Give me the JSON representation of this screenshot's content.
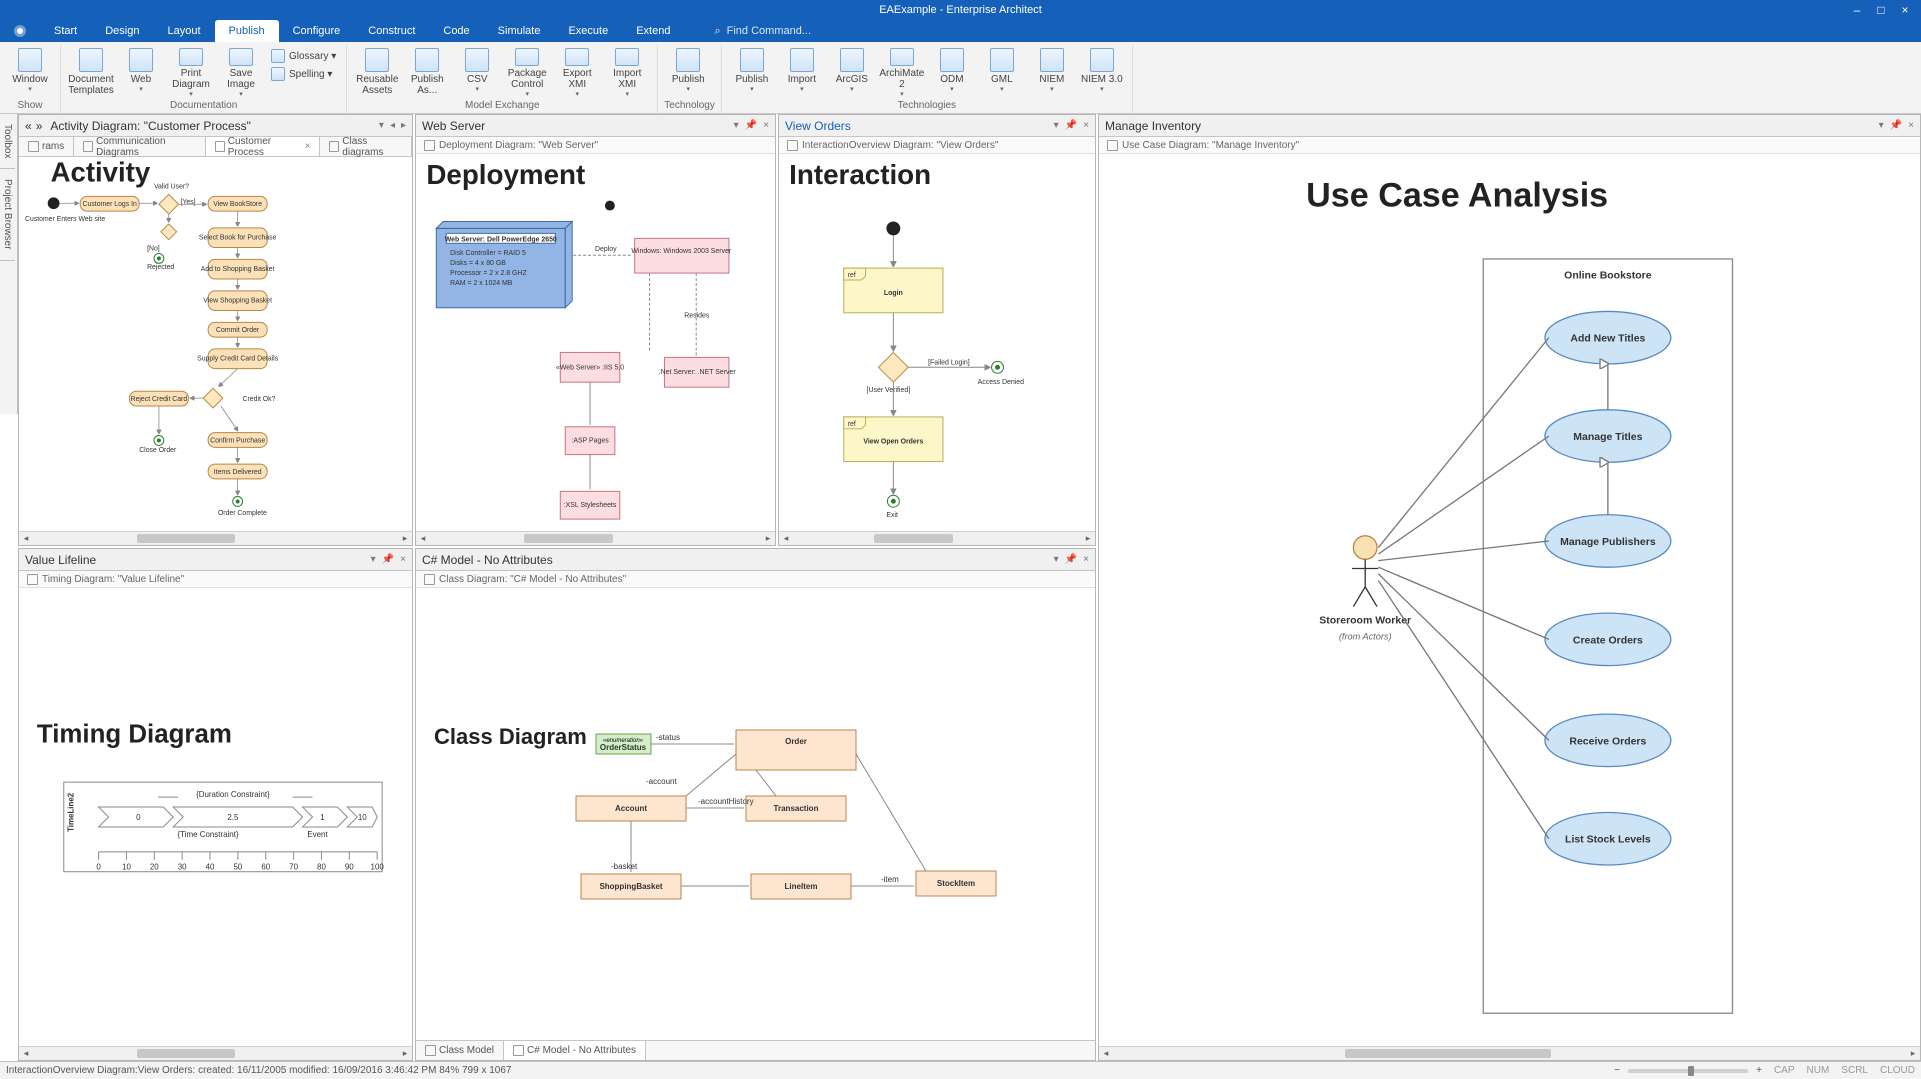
{
  "title": "EAExample - Enterprise Architect",
  "menu": [
    "Start",
    "Design",
    "Layout",
    "Publish",
    "Configure",
    "Construct",
    "Code",
    "Simulate",
    "Execute",
    "Extend"
  ],
  "menu_active": 3,
  "find_placeholder": "Find Command...",
  "ribbon": {
    "groups": [
      {
        "label": "Show",
        "big": [
          {
            "t": "Window",
            "d": true
          }
        ],
        "small": []
      },
      {
        "label": "Documentation",
        "big": [
          {
            "t": "Document Templates"
          },
          {
            "t": "Web",
            "d": true
          },
          {
            "t": "Print Diagram",
            "d": true
          },
          {
            "t": "Save Image",
            "d": true
          }
        ],
        "small": [
          {
            "t": "Glossary"
          },
          {
            "t": "Spelling"
          }
        ]
      },
      {
        "label": "Model Exchange",
        "big": [
          {
            "t": "Reusable Assets"
          },
          {
            "t": "Publish As..."
          },
          {
            "t": "CSV",
            "d": true
          },
          {
            "t": "Package Control",
            "d": true
          },
          {
            "t": "Export XMI",
            "d": true
          },
          {
            "t": "Import XMI",
            "d": true
          }
        ]
      },
      {
        "label": "Technology",
        "big": [
          {
            "t": "Publish",
            "d": true
          }
        ]
      },
      {
        "label": "Technologies",
        "big": [
          {
            "t": "Publish",
            "d": true
          },
          {
            "t": "Import",
            "d": true
          },
          {
            "t": "ArcGIS",
            "d": true
          },
          {
            "t": "ArchiMate 2",
            "d": true
          },
          {
            "t": "ODM",
            "d": true
          },
          {
            "t": "GML",
            "d": true
          },
          {
            "t": "NIEM",
            "d": true
          },
          {
            "t": "NIEM 3.0",
            "d": true
          }
        ]
      }
    ]
  },
  "side_tabs": [
    "Toolbox",
    "Project Browser"
  ],
  "panes": {
    "activity": {
      "nav_label": "Activity Diagram: \"Customer Process\"",
      "tabs": [
        "rams",
        "Communication Diagrams",
        "Customer Process",
        "Class diagrams"
      ],
      "active_tab": 2,
      "title": "Activity",
      "labels": {
        "valid": "Valid User?",
        "yes": "[Yes]",
        "no": "[No]",
        "rejected": "Rejected",
        "enters": "Customer Enters Web site",
        "creditok": "Credit Ok?",
        "closeorder": "Close Order",
        "ordercomplete": "Order Complete"
      },
      "nodes": [
        "Customer Logs In",
        "View BookStore",
        "Select Book for Purchase",
        "Add to Shopping Basket",
        "View Shopping Basket",
        "Commit Order",
        "Supply Credit Card Details",
        "Reject Credit Card",
        "Confirm Purchase",
        "Items Delivered"
      ]
    },
    "deploy": {
      "head": "Web Server",
      "sub": "Deployment Diagram: \"Web Server\"",
      "title": "Deployment",
      "server_title": "Web Server: Dell PowerEdge 2650",
      "server_specs": [
        "Disk Controller = RAID 5",
        "Disks = 4 x 80 GB",
        "Processor = 2 x 2.8 GHZ",
        "RAM = 2 x 1024 MB"
      ],
      "boxes": {
        "windows": "Windows: Windows 2003 Server",
        "iis": "«Web Server»\n:IIS 5.0",
        "net": ".Net Server:\n.NET Server",
        "asp": ":ASP\nPages",
        "xsl": ":XSL\nStylesheets"
      },
      "links": {
        "deploy": "Deploy",
        "resides": "Resides"
      }
    },
    "interaction": {
      "head": "View Orders",
      "sub": "InteractionOverview Diagram: \"View Orders\"",
      "title": "Interaction",
      "frames": {
        "login": "Login",
        "viewopen": "View Open Orders"
      },
      "ref": "ref",
      "labels": {
        "userverified": "[User Verified]",
        "failedlogin": "[Failed Login]",
        "accessdenied": "Access Denied",
        "exit": "Exit"
      }
    },
    "usecase": {
      "head": "Manage Inventory",
      "sub": "Use Case Diagram: \"Manage Inventory\"",
      "title": "Use Case Analysis",
      "system": "Online Bookstore",
      "actor": "Storeroom Worker",
      "actor_from": "(from Actors)",
      "cases": [
        "Add New Titles",
        "Manage Titles",
        "Manage Publishers",
        "Create Orders",
        "Receive Orders",
        "List Stock Levels"
      ]
    },
    "timing": {
      "head": "Value Lifeline",
      "sub": "Timing Diagram: \"Value Lifeline\"",
      "title": "Timing Diagram",
      "duration": "{Duration Constraint}",
      "timec": "{Time Constraint}",
      "event": "Event",
      "axis_label": "TimeLine2",
      "points": [
        "0",
        "2.5",
        "1",
        "10"
      ],
      "ticks": [
        "0",
        "10",
        "20",
        "30",
        "40",
        "50",
        "60",
        "70",
        "80",
        "90",
        "100"
      ]
    },
    "classd": {
      "head": "C# Model - No Attributes",
      "sub": "Class Diagram: \"C# Model - No Attributes\"",
      "title": "Class Diagram",
      "ftabs": [
        "Class Model",
        "C# Model - No Attributes"
      ],
      "enum_stereo": "«enumeration»",
      "enum_name": "OrderStatus",
      "classes": {
        "order": "Order",
        "account": "Account",
        "transaction": "Transaction",
        "basket": "ShoppingBasket",
        "lineitem": "LineItem",
        "stockitem": "StockItem"
      },
      "roles": {
        "status": "-status",
        "account": "-account",
        "history": "-accountHistory",
        "basket": "-basket",
        "item": "-item"
      }
    }
  },
  "status": {
    "text": "InteractionOverview Diagram:View Orders:  created: 16/11/2005  modified: 16/09/2016 3:46:42 PM   84%    799 x 1067",
    "indicators": [
      "CAP",
      "NUM",
      "SCRL",
      "CLOUD"
    ]
  }
}
